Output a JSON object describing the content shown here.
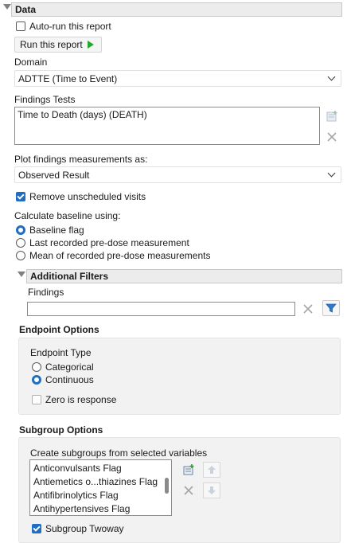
{
  "data_section": {
    "title": "Data",
    "auto_run_label": "Auto-run this report",
    "auto_run_checked": false,
    "run_button_label": "Run this report",
    "domain_label": "Domain",
    "domain_value": "ADTTE (Time to Event)",
    "findings_tests_label": "Findings Tests",
    "findings_tests_items": [
      "Time to Death (days) (DEATH)"
    ],
    "plot_label": "Plot findings measurements as:",
    "plot_value": "Observed Result",
    "remove_unscheduled_label": "Remove unscheduled visits",
    "remove_unscheduled_checked": true,
    "baseline_label": "Calculate baseline using:",
    "baseline_options": [
      "Baseline flag",
      "Last recorded pre-dose measurement",
      "Mean of recorded pre-dose measurements"
    ],
    "baseline_selected": 0
  },
  "additional_filters": {
    "title": "Additional Filters",
    "findings_label": "Findings",
    "findings_value": "",
    "endpoint_options": {
      "title": "Endpoint Options",
      "endpoint_type_label": "Endpoint Type",
      "type_options": [
        "Categorical",
        "Continuous"
      ],
      "type_selected": 1,
      "zero_is_response_label": "Zero is response",
      "zero_is_response_checked": false
    },
    "subgroup_options": {
      "title": "Subgroup Options",
      "create_label": "Create subgroups from selected variables",
      "variables": [
        "Anticonvulsants Flag",
        "Antiemetics o...thiazines Flag",
        "Antifibrinolytics Flag",
        "Antihypertensives Flag"
      ],
      "twoway_label": "Subgroup Twoway",
      "twoway_checked": true
    }
  },
  "colors": {
    "accent": "#1f6ec4",
    "play": "#22a82a",
    "header_bg": "#ececec",
    "panel_bg": "#f2f2f2"
  }
}
